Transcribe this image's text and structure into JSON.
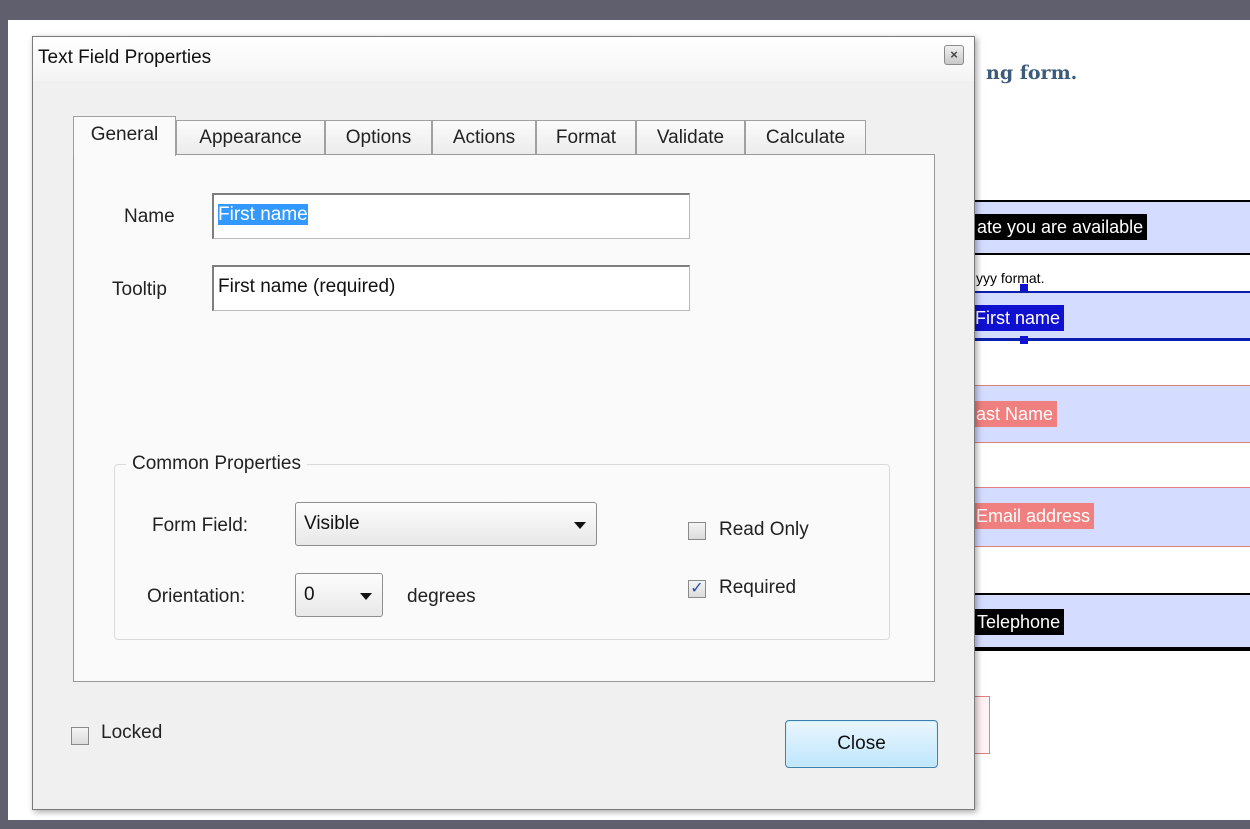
{
  "background_doc": {
    "heading": "ng form.",
    "fields": {
      "date_label": "ate you are available",
      "hint": "yyy format.",
      "first_name": "First name",
      "last_name": "ast Name",
      "email": "Email address",
      "telephone": "Telephone"
    }
  },
  "dialog": {
    "title": "Text Field Properties",
    "close_glyph": "×",
    "tabs": [
      {
        "label": "General",
        "active": true
      },
      {
        "label": "Appearance"
      },
      {
        "label": "Options"
      },
      {
        "label": "Actions"
      },
      {
        "label": "Format"
      },
      {
        "label": "Validate"
      },
      {
        "label": "Calculate"
      }
    ],
    "general": {
      "name_label": "Name",
      "name_value": "First name",
      "tooltip_label": "Tooltip",
      "tooltip_value": "First name (required)"
    },
    "common": {
      "title": "Common Properties",
      "form_field_label": "Form Field:",
      "form_field_value": "Visible",
      "orientation_label": "Orientation:",
      "orientation_value": "0",
      "degrees_label": "degrees",
      "read_only_label": "Read Only",
      "read_only_checked": false,
      "required_label": "Required",
      "required_checked": true,
      "check_glyph": "✓"
    },
    "locked_label": "Locked",
    "locked_checked": false,
    "close_button": "Close"
  },
  "colors": {
    "selection": "#3399ff",
    "field_fill": "#d4dcff",
    "required_border": "#e08080",
    "close_button_border": "#3c7fb1"
  },
  "icons": {
    "dropdown_arrow": "chevron-down-icon",
    "window_close": "close-icon",
    "checkmark": "check-icon"
  }
}
